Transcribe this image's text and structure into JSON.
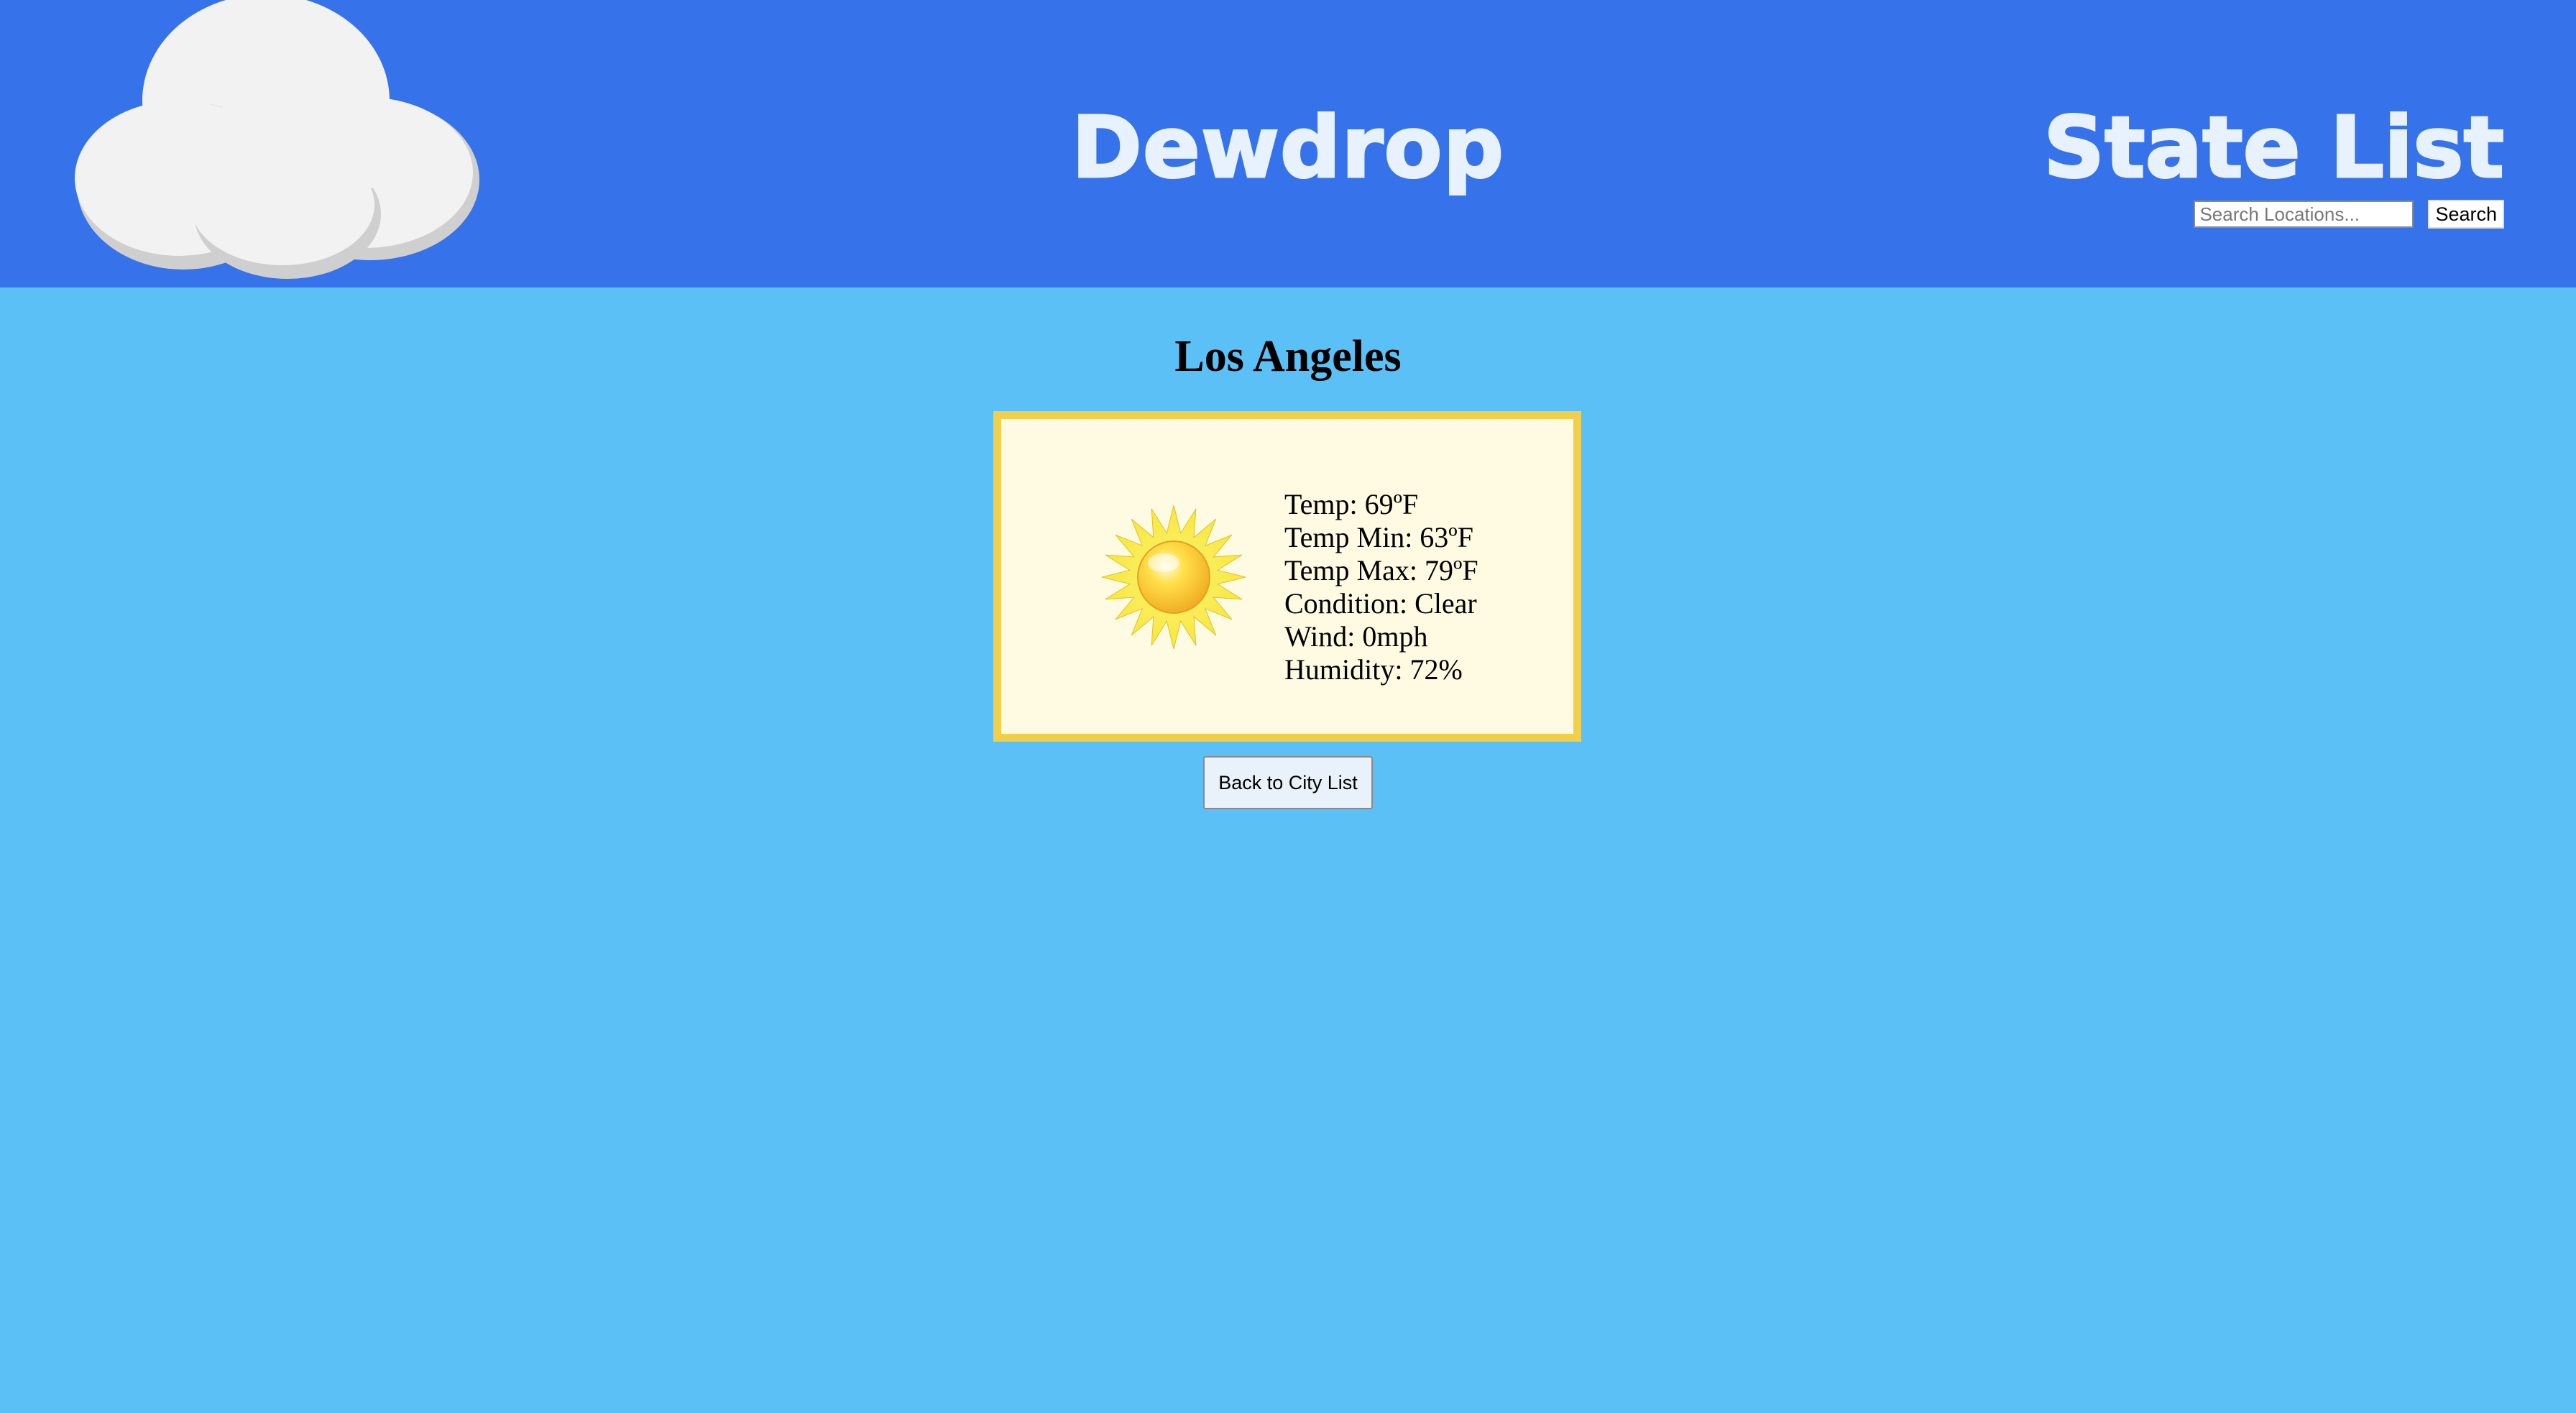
{
  "header": {
    "logo_icon": "cloud-icon",
    "brand": "Dewdrop",
    "nav_link": "State List",
    "search": {
      "placeholder": "Search Locations...",
      "value": "",
      "button_label": "Search"
    }
  },
  "colors": {
    "header_background": "#3673ea",
    "page_background": "#5bc0f5",
    "card_border": "#f2cf4a",
    "card_background": "#fefbe2",
    "brand_text": "#e8f2ff"
  },
  "city": {
    "name": "Los Angeles"
  },
  "weather": {
    "icon": "sun-icon",
    "temp": "Temp: 69ºF",
    "temp_min": "Temp Min: 63ºF",
    "temp_max": "Temp Max: 79ºF",
    "condition": "Condition: Clear",
    "wind": "Wind: 0mph",
    "humidity": "Humidity: 72%"
  },
  "actions": {
    "back_label": "Back to City List"
  }
}
